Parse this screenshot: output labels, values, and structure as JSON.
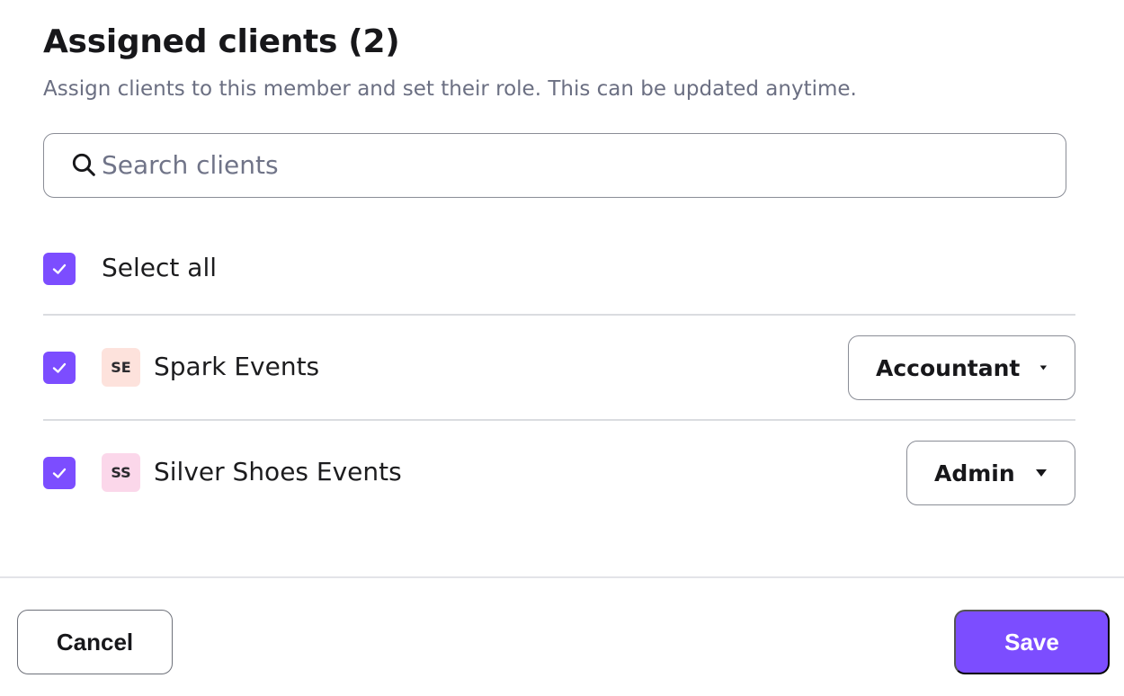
{
  "header": {
    "title": "Assigned clients (2)",
    "subtitle": "Assign clients to this member and set their role. This can be updated anytime."
  },
  "search": {
    "placeholder": "Search clients",
    "value": ""
  },
  "select_all": {
    "label": "Select all",
    "checked": true
  },
  "clients": [
    {
      "initials": "SE",
      "name": "Spark Events",
      "role": "Accountant",
      "checked": true,
      "avatar_color": "#fde2dc"
    },
    {
      "initials": "SS",
      "name": "Silver Shoes Events",
      "role": "Admin",
      "checked": true,
      "avatar_color": "#fbd7ea"
    }
  ],
  "footer": {
    "cancel_label": "Cancel",
    "save_label": "Save"
  },
  "colors": {
    "accent": "#7c4dff",
    "border": "#8a8d96",
    "muted_text": "#6b6f82"
  }
}
